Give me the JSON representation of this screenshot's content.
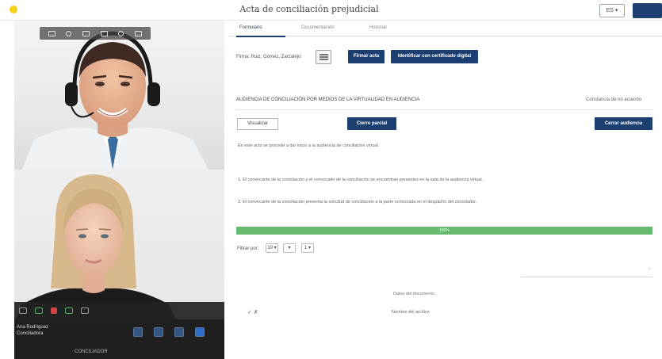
{
  "header": {
    "title": "Acta de conciliación prejudicial",
    "lang_label": "ES ▾",
    "brand_color": "#f5d21a",
    "accent_color": "#1c3f72"
  },
  "video": {
    "toolbar_icons": [
      "video-icon",
      "mic-icon",
      "screen-icon",
      "chat-icon",
      "settings-icon",
      "expand-icon"
    ],
    "call_controls": [
      "mic-icon",
      "camera-icon",
      "hangup-icon",
      "share-icon",
      "more-icon"
    ],
    "participant_name": "Ana Rodríguez",
    "participant_role": "Conciliadora",
    "footer_label": "CONCILIADOR"
  },
  "tabs": [
    {
      "label": "Formulario",
      "active": true
    },
    {
      "label": "Documentación",
      "active": false
    },
    {
      "label": "Historial",
      "active": false
    }
  ],
  "signing": {
    "signer_label": "Firma: Ruiz, Gómez, Zarzalejo",
    "sign_button": "Firmar acta",
    "cert_button": "Identificar con certificado digital"
  },
  "section": {
    "title": "AUDIENCIA DE CONCILIACIÓN POR MEDIOS DE LA VIRTUALIDAD EN AUDIENCIA",
    "right_label": "Constancia de no acuerdo",
    "btn_left": "Visualizar",
    "btn_mid": "Cierre parcial",
    "btn_right": "Cerrar audiencia"
  },
  "body_lines": [
    "En este acto se procede a dar inicio a la audiencia de conciliación virtual.",
    "1. El convocante de la conciliación y el convocado de la conciliación se encuentran presentes en la sala de la audiencia virtual.",
    "2. El convocante de la conciliación presenta la solicitud de conciliación a la parte convocada en el despacho del conciliador."
  ],
  "progress": {
    "label": "100%",
    "value": 1.0
  },
  "pager": {
    "label": "Filtrar por:",
    "fields": [
      "10 ▾",
      "▾",
      "1 ▾"
    ]
  },
  "table": {
    "column_header": "Datos del documento",
    "row_icons": "✓ ✗",
    "row_value": "Nombre del archivo"
  }
}
